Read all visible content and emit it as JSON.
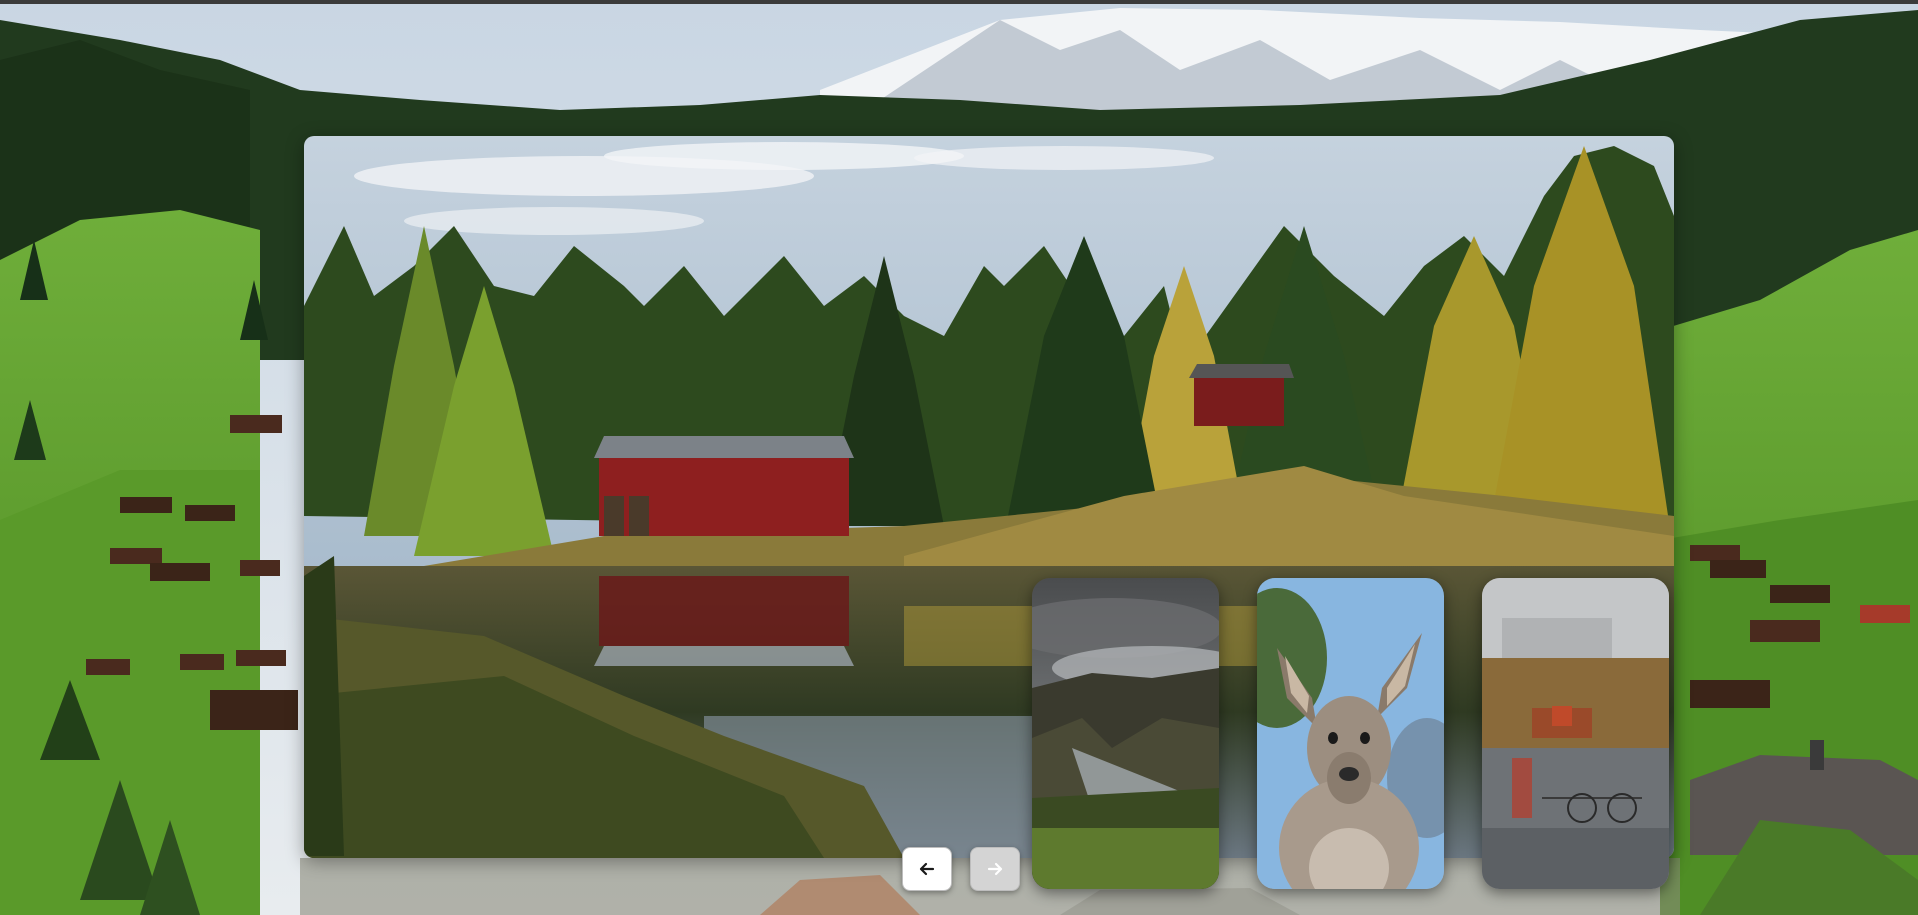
{
  "carousel": {
    "background_image": "alpine-valley-village",
    "main_slide": {
      "image": "red-barn-lake-reflection"
    },
    "thumbnails": [
      {
        "image": "stormy-sky-rocky-stream"
      },
      {
        "image": "kangaroo-portrait"
      },
      {
        "image": "city-reflection-in-glass"
      }
    ],
    "controls": {
      "prev_icon": "arrow-left-icon",
      "next_icon": "arrow-right-icon"
    }
  },
  "colors": {
    "prev_button_bg": "#ffffff",
    "next_button_bg": "#d4d4d4",
    "barn_red": "#8e1f1f",
    "sky_blue": "#9eb6cc"
  }
}
